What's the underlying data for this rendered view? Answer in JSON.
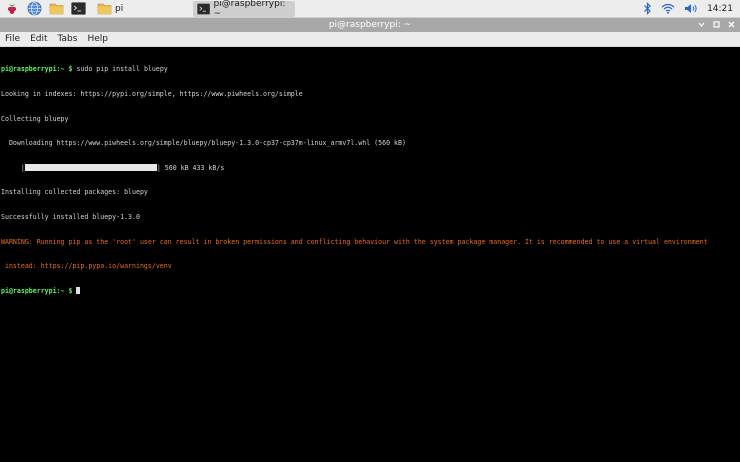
{
  "panel": {
    "task_active_label": "pi@raspberrypi: ~",
    "task_files_label": "pi",
    "clock": "14:21",
    "colors": {
      "panel_bg": "#ededed",
      "active_task": "#cfcfcf"
    }
  },
  "window": {
    "title": "pi@raspberrypi: ~"
  },
  "menu": {
    "file": "File",
    "edit": "Edit",
    "tabs": "Tabs",
    "help": "Help"
  },
  "terminal": {
    "prompt_user": "pi@raspberrypi",
    "prompt_suffix": ":~ $",
    "command": "sudo pip install bluepy",
    "lines": [
      "Looking in indexes: https://pypi.org/simple, https://www.piwheels.org/simple",
      "Collecting bluepy",
      "  Downloading https://www.piwheels.org/simple/bluepy/bluepy-1.3.0-cp37-cp37m-linux_armv7l.whl (560 kB)"
    ],
    "progress_prefix": "     |",
    "progress_suffix": "| 560 kB 433 kB/s",
    "progress_fraction": 1.0,
    "after_lines": [
      "Installing collected packages: bluepy",
      "Successfully installed bluepy-1.3.0"
    ],
    "warning_line1": "WARNING: Running pip as the 'root' user can result in broken permissions and conflicting behaviour with the system package manager. It is recommended to use a virtual environment",
    "warning_line2": " instead: https://pip.pypa.io/warnings/venv",
    "colors": {
      "prompt": "#5ef25e",
      "warning": "#e66c1c",
      "text": "#d3d3d3"
    }
  }
}
